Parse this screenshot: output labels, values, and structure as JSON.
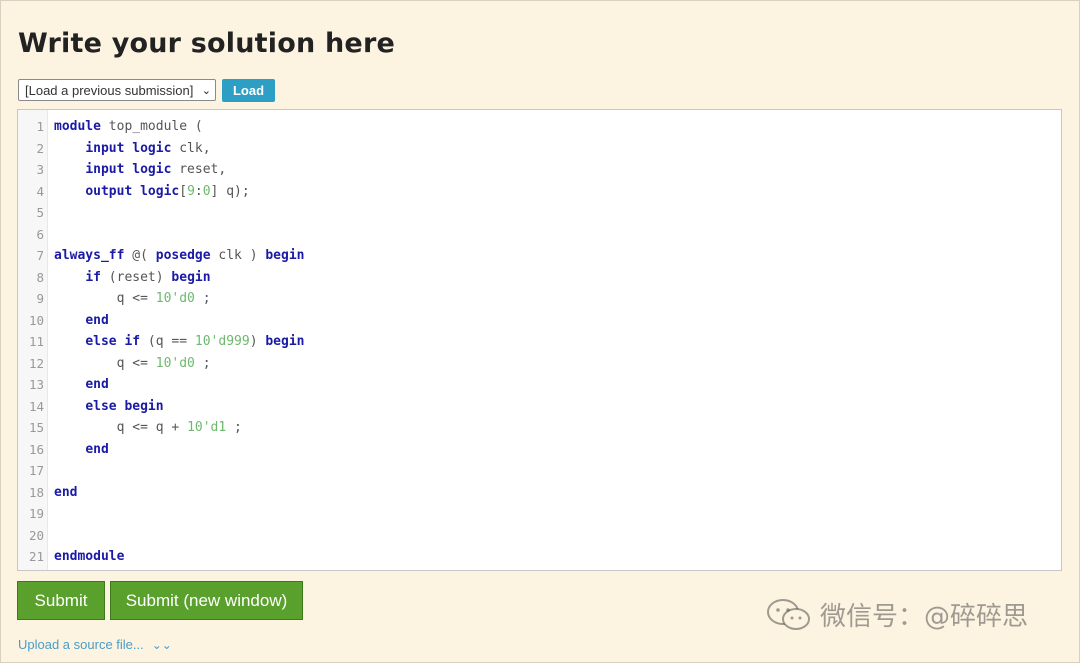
{
  "title": "Write your solution here",
  "toolbar": {
    "select_value": "[Load a previous submission]",
    "load_label": "Load"
  },
  "code": {
    "lines": [
      [
        {
          "t": "module",
          "c": "kw"
        },
        {
          "t": " top_module (",
          "c": ""
        }
      ],
      [
        {
          "t": "    ",
          "c": ""
        },
        {
          "t": "input logic",
          "c": "kw"
        },
        {
          "t": " clk,",
          "c": ""
        }
      ],
      [
        {
          "t": "    ",
          "c": ""
        },
        {
          "t": "input logic",
          "c": "kw"
        },
        {
          "t": " reset,",
          "c": ""
        }
      ],
      [
        {
          "t": "    ",
          "c": ""
        },
        {
          "t": "output logic",
          "c": "kw"
        },
        {
          "t": "[",
          "c": ""
        },
        {
          "t": "9",
          "c": "num"
        },
        {
          "t": ":",
          "c": ""
        },
        {
          "t": "0",
          "c": "num"
        },
        {
          "t": "] q);",
          "c": ""
        }
      ],
      [],
      [],
      [
        {
          "t": "always_ff",
          "c": "kw"
        },
        {
          "t": " @( ",
          "c": ""
        },
        {
          "t": "posedge",
          "c": "kw"
        },
        {
          "t": " clk ) ",
          "c": ""
        },
        {
          "t": "begin",
          "c": "kw"
        }
      ],
      [
        {
          "t": "    ",
          "c": ""
        },
        {
          "t": "if",
          "c": "kw"
        },
        {
          "t": " (reset) ",
          "c": ""
        },
        {
          "t": "begin",
          "c": "kw"
        }
      ],
      [
        {
          "t": "        q <= ",
          "c": ""
        },
        {
          "t": "10'd0",
          "c": "num"
        },
        {
          "t": " ;",
          "c": ""
        }
      ],
      [
        {
          "t": "    ",
          "c": ""
        },
        {
          "t": "end",
          "c": "kw"
        }
      ],
      [
        {
          "t": "    ",
          "c": ""
        },
        {
          "t": "else if",
          "c": "kw"
        },
        {
          "t": " (q == ",
          "c": ""
        },
        {
          "t": "10'd999",
          "c": "num"
        },
        {
          "t": ") ",
          "c": ""
        },
        {
          "t": "begin",
          "c": "kw"
        }
      ],
      [
        {
          "t": "        q <= ",
          "c": ""
        },
        {
          "t": "10'd0",
          "c": "num"
        },
        {
          "t": " ;",
          "c": ""
        }
      ],
      [
        {
          "t": "    ",
          "c": ""
        },
        {
          "t": "end",
          "c": "kw"
        }
      ],
      [
        {
          "t": "    ",
          "c": ""
        },
        {
          "t": "else begin",
          "c": "kw"
        }
      ],
      [
        {
          "t": "        q <= q + ",
          "c": ""
        },
        {
          "t": "10'd1",
          "c": "num"
        },
        {
          "t": " ;",
          "c": ""
        }
      ],
      [
        {
          "t": "    ",
          "c": ""
        },
        {
          "t": "end",
          "c": "kw"
        }
      ],
      [],
      [
        {
          "t": "end",
          "c": "kw"
        }
      ],
      [],
      [],
      [
        {
          "t": "endmodule",
          "c": "kw"
        }
      ]
    ]
  },
  "buttons": {
    "submit_label": "Submit",
    "submit_new_window_label": "Submit (new window)"
  },
  "upload_label": "Upload a source file...",
  "watermark_text": "微信号：@碎碎思",
  "colors": {
    "background": "#fdf3e1",
    "load_button": "#2d9fc5",
    "submit_button": "#5aa02c",
    "keyword": "#1a1aa6",
    "number": "#6fb86f",
    "link": "#4a9dc8"
  }
}
